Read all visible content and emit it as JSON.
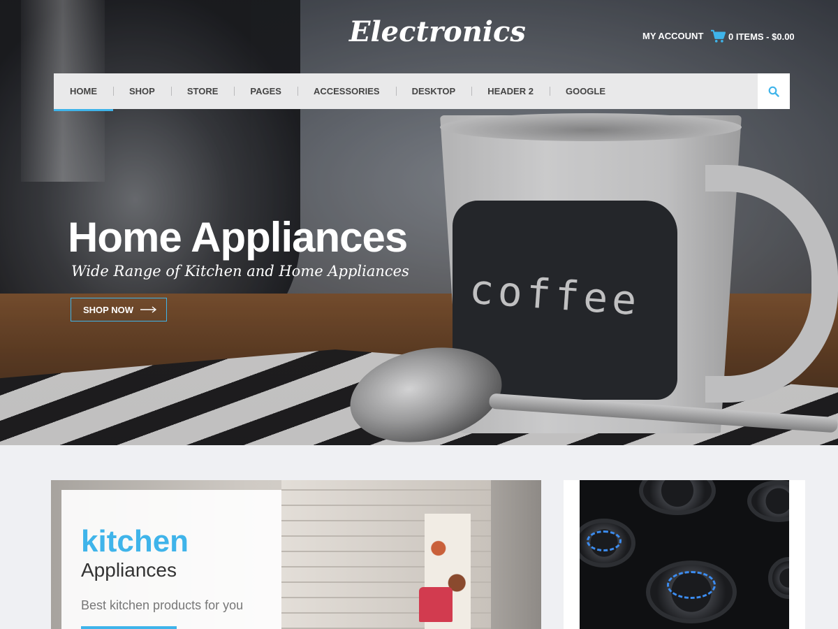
{
  "header": {
    "logo": "Electronics",
    "account_label": "MY ACCOUNT",
    "cart_label": "0 ITEMS - $0.00"
  },
  "nav": {
    "items": [
      "HOME",
      "SHOP",
      "STORE",
      "PAGES",
      "ACCESSORIES",
      "DESKTOP",
      "HEADER 2",
      "GOOGLE"
    ],
    "active": "HOME",
    "search_icon": "search-icon"
  },
  "hero": {
    "title": "Home Appliances",
    "subtitle": "Wide Range of Kitchen and Home Appliances",
    "button_label": "SHOP NOW",
    "mug_text": "coffee"
  },
  "cards": {
    "kitchen": {
      "keyword": "kitchen",
      "heading": "Appliances",
      "text": "Best kitchen products for you"
    }
  },
  "colors": {
    "accent": "#3fb4ea",
    "nav_bg": "#e9e9ea",
    "page_bg": "#eff0f3"
  }
}
